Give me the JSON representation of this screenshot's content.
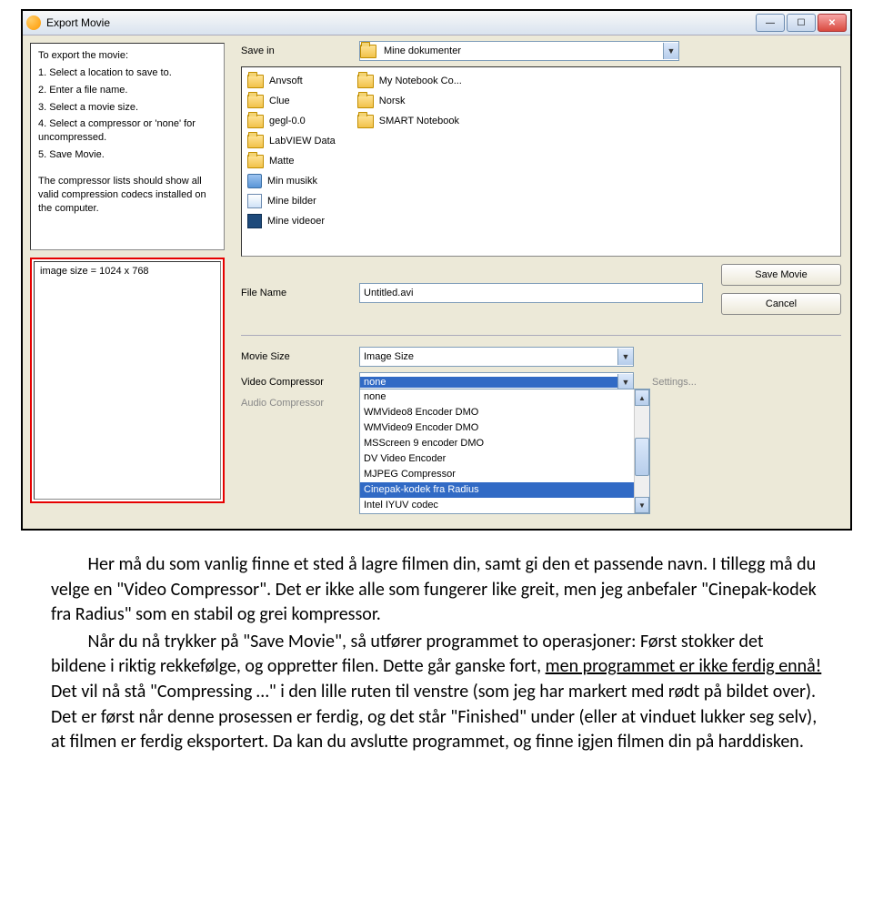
{
  "window": {
    "title": "Export Movie"
  },
  "instructions": {
    "heading": "To export the movie:",
    "steps": [
      "1. Select a location to save to.",
      "2. Enter a file name.",
      "3. Select a movie size.",
      "4. Select a compressor or 'none' for uncompressed.",
      "5. Save Movie."
    ],
    "note": "The compressor lists should show all valid compression codecs installed on the computer."
  },
  "status_box": "image size = 1024 x 768",
  "save_in": {
    "label": "Save in",
    "value": "Mine dokumenter"
  },
  "browser": {
    "col1": [
      {
        "name": "Anvsoft",
        "icon": "folder"
      },
      {
        "name": "Clue",
        "icon": "folder"
      },
      {
        "name": "gegl-0.0",
        "icon": "folder"
      },
      {
        "name": "LabVIEW Data",
        "icon": "folder"
      },
      {
        "name": "Matte",
        "icon": "folder"
      },
      {
        "name": "Min musikk",
        "icon": "note"
      },
      {
        "name": "Mine bilder",
        "icon": "pic"
      },
      {
        "name": "Mine videoer",
        "icon": "vid"
      }
    ],
    "col2": [
      {
        "name": "My Notebook Co...",
        "icon": "folder"
      },
      {
        "name": "Norsk",
        "icon": "folder"
      },
      {
        "name": "SMART Notebook",
        "icon": "folder"
      }
    ]
  },
  "file_name": {
    "label": "File Name",
    "value": "Untitled.avi"
  },
  "buttons": {
    "save": "Save Movie",
    "cancel": "Cancel"
  },
  "movie_size": {
    "label": "Movie Size",
    "value": "Image Size"
  },
  "video_compressor": {
    "label": "Video Compressor",
    "value": "none",
    "settings": "Settings...",
    "options": [
      "none",
      "WMVideo8 Encoder DMO",
      "WMVideo9 Encoder DMO",
      "MSScreen 9 encoder DMO",
      "DV Video Encoder",
      "MJPEG Compressor",
      "Cinepak-kodek fra Radius",
      "Intel IYUV codec"
    ],
    "selected_index": 6
  },
  "audio_compressor": {
    "label": "Audio Compressor"
  },
  "article": {
    "p1a": "Her må du som vanlig finne et sted å lagre filmen din, samt gi den et passende navn. I tillegg må du velge en \"Video Compressor\". Det er ikke alle som fungerer like greit, men jeg anbefaler \"Cinepak-kodek fra Radius\" som en stabil og grei kompressor.",
    "p2a": "Når du nå trykker på \"Save Movie\", så utfører programmet to operasjoner: Først stokker det bildene i riktig rekkefølge, og oppretter filen. Dette går ganske fort, ",
    "p2u": "men programmet er ikke ferdig ennå!",
    "p2b": " Det vil nå stå \"Compressing …\" i den lille ruten til venstre (som jeg har markert med rødt på bildet over). Det er først når denne prosessen er ferdig, og det står \"Finished\" under (eller at vinduet lukker seg selv), at filmen er ferdig eksportert. Da kan du avslutte programmet, og finne igjen filmen din på harddisken."
  }
}
